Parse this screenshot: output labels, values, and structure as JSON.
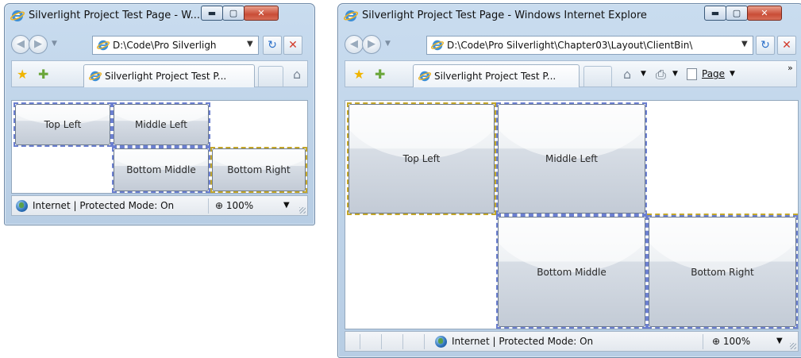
{
  "small_window": {
    "title": "Silverlight Project Test Page - W...",
    "address": "D:\\Code\\Pro Silverligh",
    "tab_label": "Silverlight Project Test P...",
    "buttons": {
      "top_left": "Top Left",
      "middle_left": "Middle Left",
      "bottom_middle": "Bottom Middle",
      "bottom_right": "Bottom Right"
    },
    "status_text": "Internet | Protected Mode: On",
    "zoom": "100%"
  },
  "large_window": {
    "title": "Silverlight Project Test Page - Windows Internet Explorer",
    "address": "D:\\Code\\Pro Silverlight\\Chapter03\\Layout\\ClientBin\\",
    "tab_label": "Silverlight Project Test P...",
    "page_menu": "Page",
    "buttons": {
      "top_left": "Top Left",
      "middle_left": "Middle Left",
      "bottom_middle": "Bottom Middle",
      "bottom_right": "Bottom Right"
    },
    "status_text": "Internet | Protected Mode: On",
    "zoom": "100%"
  },
  "glyphs": {
    "minimize": "▬",
    "maximize": "▢",
    "close": "✕",
    "back": "◀",
    "forward": "▶",
    "dropdown": "▼",
    "refresh": "↻",
    "stop": "✕",
    "star": "★",
    "add_fav": "✚",
    "home": "⌂",
    "print": "⎙",
    "more": "»",
    "zoom_icon": "⊕"
  },
  "colors": {
    "grid_dash": "#6b7fd0",
    "grid_dash_alt": "#c4a72a",
    "stop_red": "#d23b2b",
    "refresh_blue": "#2a6fc9",
    "star_gold": "#f0b400",
    "add_green": "#6aa63a"
  }
}
